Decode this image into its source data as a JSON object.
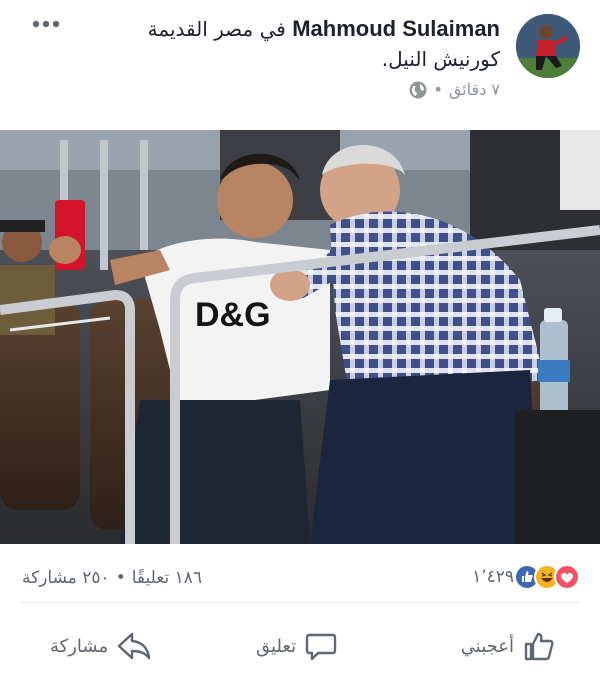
{
  "post": {
    "author": "Mahmoud Sulaiman",
    "location_prefix": "في",
    "location": "مصر القديمة",
    "body": "كورنيش النيل.",
    "time": "٧ دقائق",
    "separator": "•",
    "audience_icon": "globe-icon",
    "menu_icon": "more-options-icon"
  },
  "stats": {
    "reactions": [
      "love-reaction-icon",
      "haha-reaction-icon",
      "like-reaction-icon"
    ],
    "reaction_count": "١٬٤٢٩",
    "comments": "١٨٦ تعليقًا",
    "shares": "٢٥٠ مشاركة",
    "separator": "•"
  },
  "actions": {
    "like_label": "أعجبني",
    "comment_label": "تعليق",
    "share_label": "مشاركة"
  },
  "colors": {
    "like_blue": "#4267b2",
    "love_red": "#f25268",
    "haha_yellow": "#f7b125",
    "meta_gray": "#90949c"
  }
}
